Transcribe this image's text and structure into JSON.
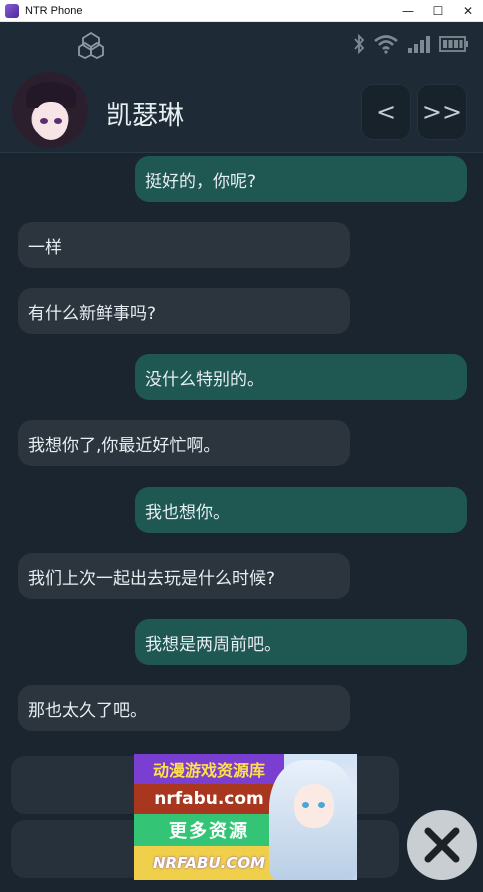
{
  "window": {
    "title": "NTR Phone",
    "controls": {
      "minimize": "—",
      "maximize": "☐",
      "close": "✕"
    }
  },
  "statusbar": {
    "icons": [
      "app-logo-icon",
      "bluetooth-icon",
      "wifi-icon",
      "signal-icon",
      "battery-icon"
    ]
  },
  "header": {
    "contact_name": "凯瑟琳",
    "prev_label": "<",
    "skip_label": ">>"
  },
  "messages": [
    {
      "side": "right",
      "text": "挺好的，你呢?"
    },
    {
      "side": "left",
      "text": "一样"
    },
    {
      "side": "left",
      "text": "有什么新鲜事吗?"
    },
    {
      "side": "right",
      "text": "没什么特别的。"
    },
    {
      "side": "left",
      "text": "我想你了,你最近好忙啊。"
    },
    {
      "side": "right",
      "text": "我也想你。"
    },
    {
      "side": "left",
      "text": "我们上次一起出去玩是什么时候?"
    },
    {
      "side": "right",
      "text": "我想是两周前吧。"
    },
    {
      "side": "left",
      "text": "那也太久了吧。"
    }
  ],
  "ad": {
    "line1": "动漫游戏资源库",
    "line2": "nrfabu.com",
    "line3": "更多资源",
    "line4": "NRFABU.COM"
  },
  "colors": {
    "background": "#1b2530",
    "bubble_left": "#2c343d",
    "bubble_right": "#1f5753",
    "text": "#e7eef1"
  }
}
